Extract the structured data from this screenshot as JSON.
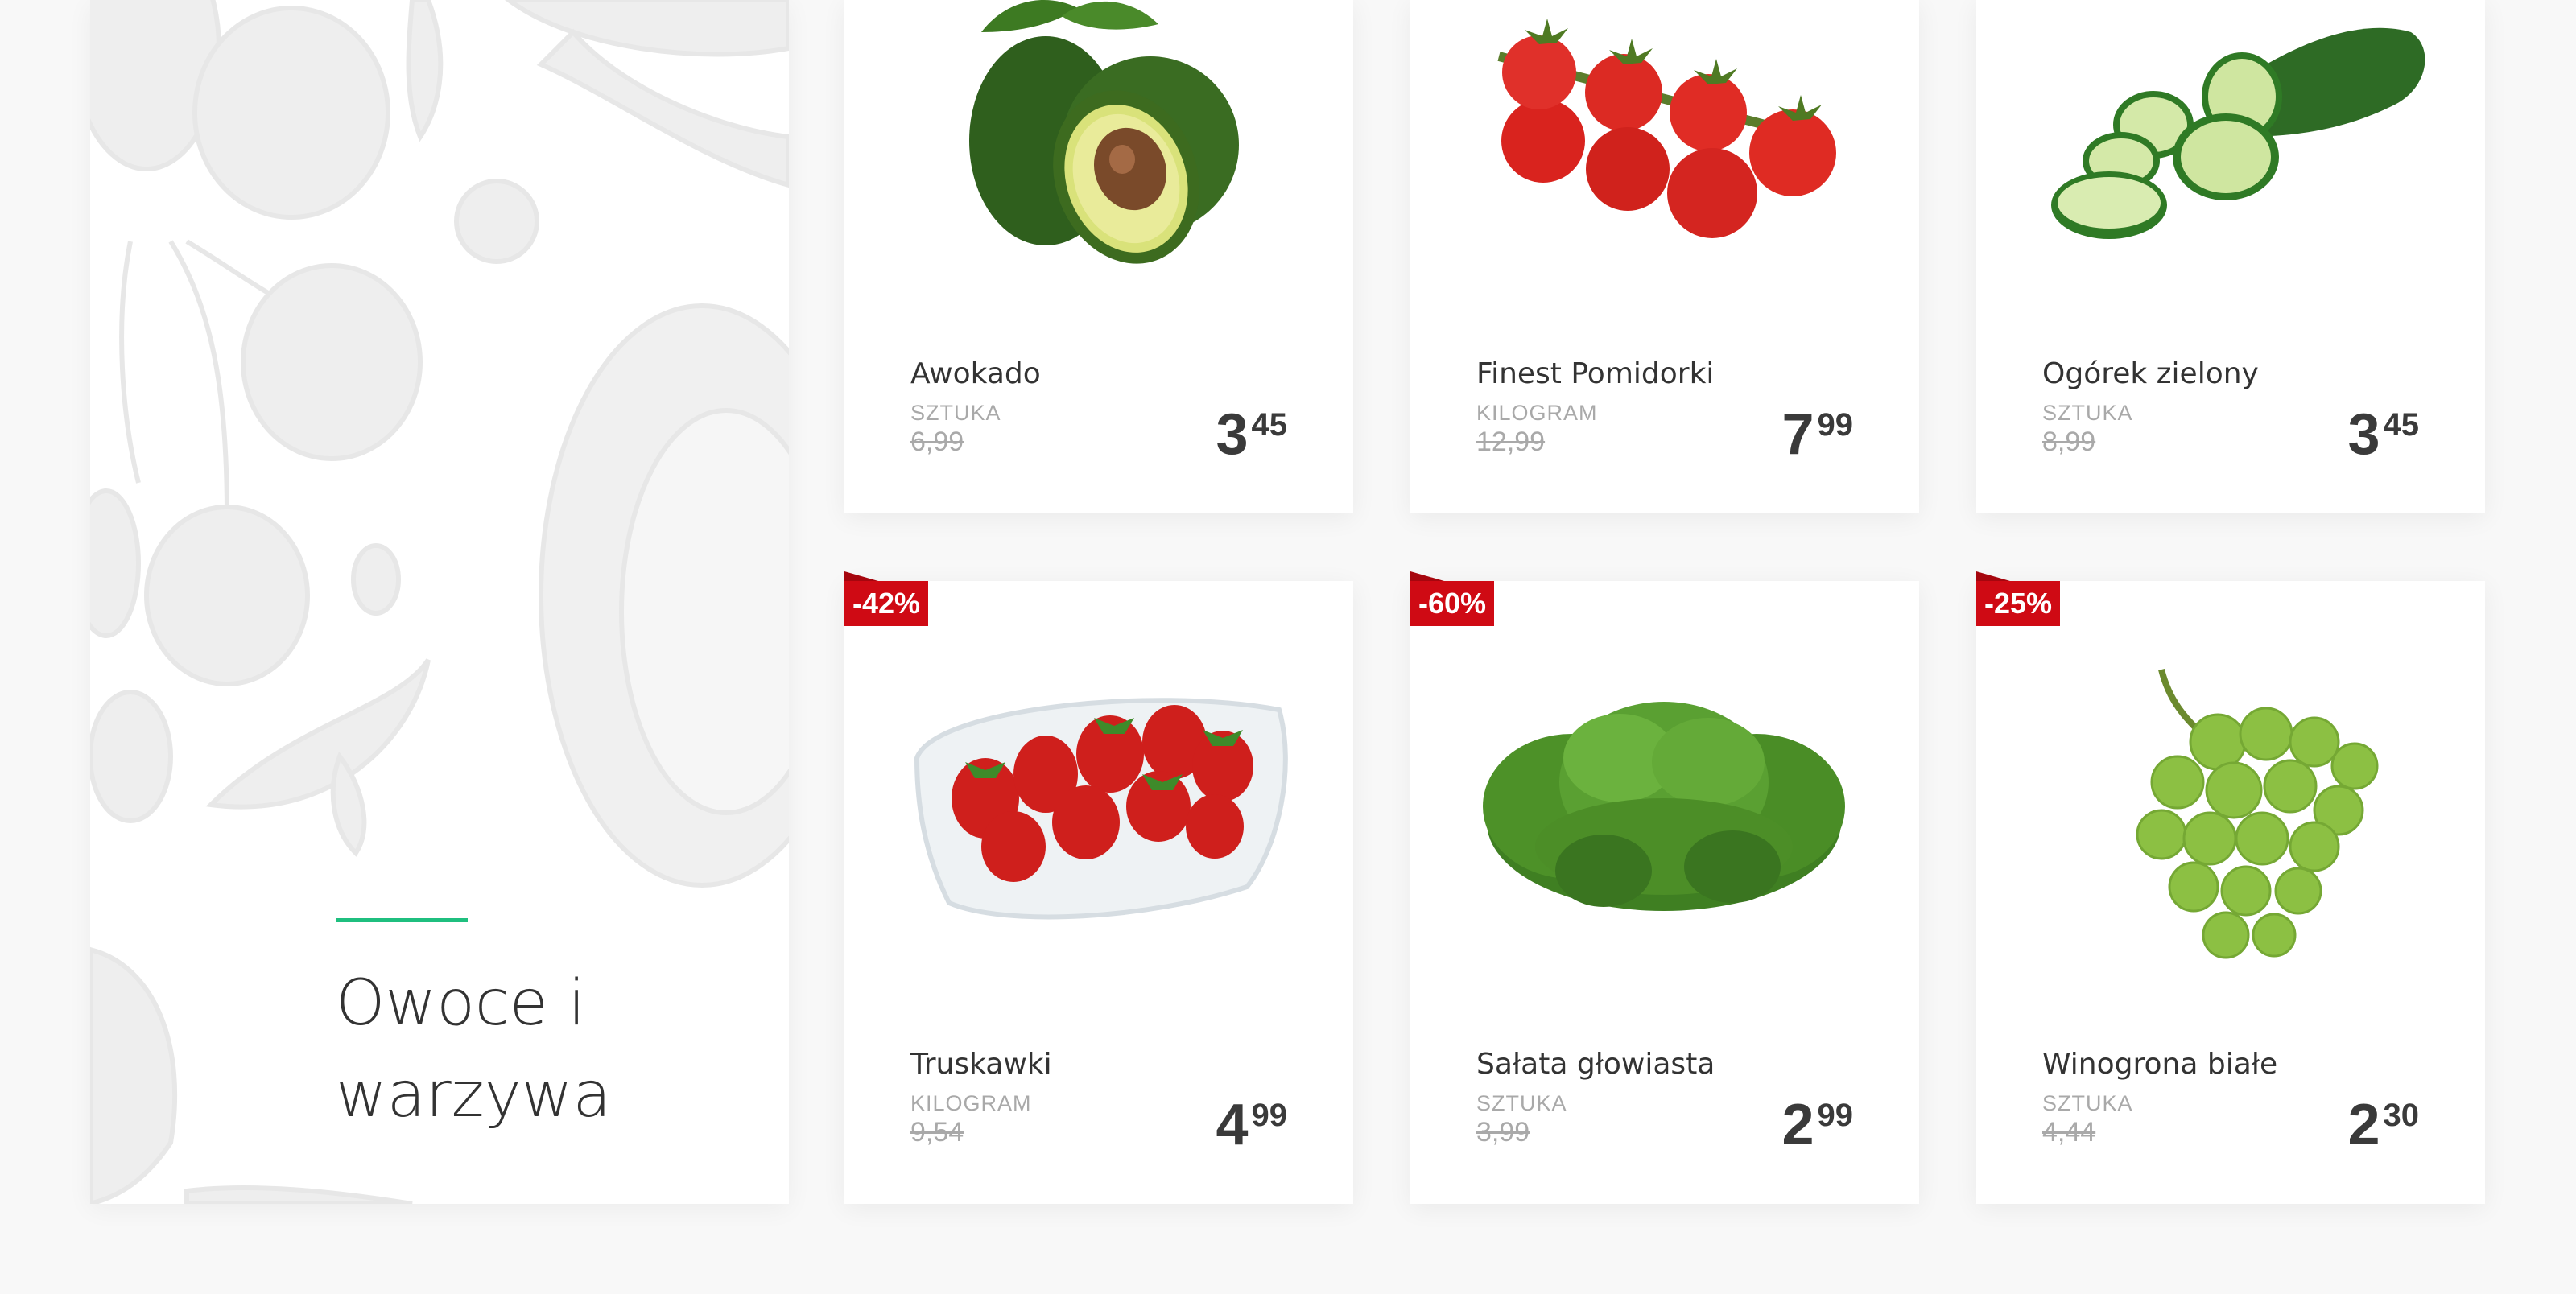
{
  "category": {
    "title_line1": "Owoce i",
    "title_line2": "warzywa",
    "accent_color": "#1fbf7f"
  },
  "products": [
    {
      "name": "Awokado",
      "unit": "SZTUKA",
      "old_price": "6,99",
      "price_int": "3",
      "price_dec": "45",
      "image": "avocado-image"
    },
    {
      "name": "Finest Pomidorki",
      "unit": "KILOGRAM",
      "old_price": "12,99",
      "price_int": "7",
      "price_dec": "99",
      "image": "cherry-tomatoes-image"
    },
    {
      "name": "Ogórek zielony",
      "unit": "SZTUKA",
      "old_price": "8,99",
      "price_int": "3",
      "price_dec": "45",
      "image": "cucumber-image"
    },
    {
      "name": "Truskawki",
      "unit": "KILOGRAM",
      "old_price": "9,54",
      "price_int": "4",
      "price_dec": "99",
      "badge": "-42%",
      "image": "strawberries-image"
    },
    {
      "name": "Sałata głowiasta",
      "unit": "SZTUKA",
      "old_price": "3,99",
      "price_int": "2",
      "price_dec": "99",
      "badge": "-60%",
      "image": "lettuce-image"
    },
    {
      "name": "Winogrona białe",
      "unit": "SZTUKA",
      "old_price": "4,44",
      "price_int": "2",
      "price_dec": "30",
      "badge": "-25%",
      "image": "green-grapes-image"
    }
  ],
  "colors": {
    "badge": "#cf0a14",
    "background": "#f8f8f8",
    "card": "#ffffff"
  }
}
